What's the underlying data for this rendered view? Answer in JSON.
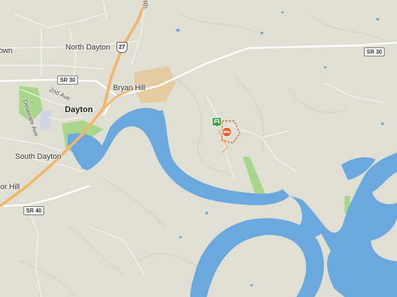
{
  "map": {
    "colors": {
      "land": "#dfdfd4",
      "water": "#6aa8de",
      "park": "#a8d68a",
      "urban": "#e9c9a0",
      "road_major": "#ffffff",
      "highway": "#f2b66b",
      "poi_green": "#3d9b3d",
      "poi_orange": "#e8632a"
    },
    "places": {
      "north_dayton": "North Dayton",
      "dayton": "Dayton",
      "bryan_hill": "Bryan Hill",
      "south_dayton": "South Dayton",
      "town_partial": "own",
      "taylor_hill_partial": "lor Hill"
    },
    "streets": {
      "second_ave": "2nd Ave",
      "delaware_ave": "Delaware Ave",
      "rhea_partial": "Rh"
    },
    "shields": {
      "sr30_west": "SR 30",
      "sr30_east": "SR 30",
      "sr40": "SR 40",
      "us27": "27"
    },
    "pois": {
      "picnic_icon": "picnic-table-icon",
      "campground_icon": "camping-bed-icon"
    }
  }
}
